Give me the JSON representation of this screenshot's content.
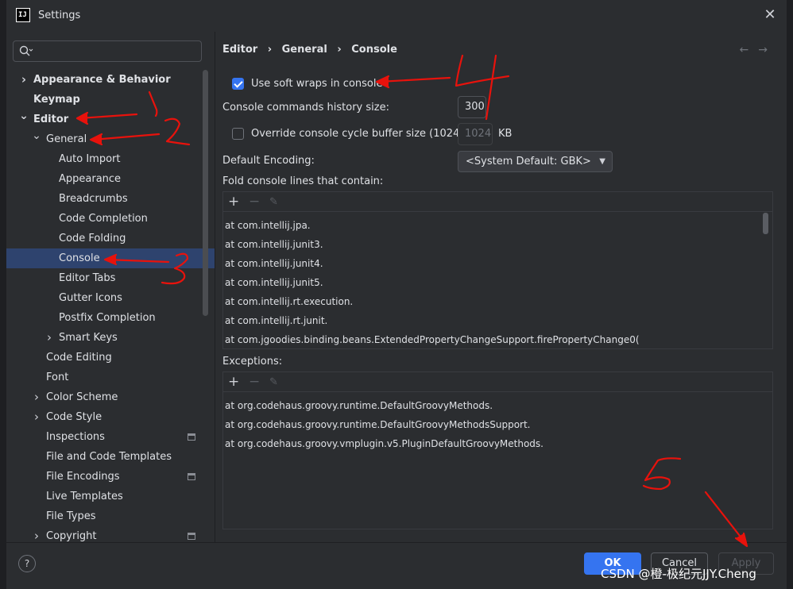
{
  "window": {
    "title": "Settings",
    "app_icon": "IJ"
  },
  "search": {
    "placeholder": ""
  },
  "tree": [
    {
      "label": "Appearance & Behavior",
      "bold": true,
      "chevron": "right"
    },
    {
      "label": "Keymap",
      "bold": true,
      "chevron": ""
    },
    {
      "label": "Editor",
      "bold": true,
      "chevron": "down"
    },
    {
      "label": "General",
      "bold": false,
      "chevron": "down"
    },
    {
      "label": "Auto Import"
    },
    {
      "label": "Appearance"
    },
    {
      "label": "Breadcrumbs"
    },
    {
      "label": "Code Completion"
    },
    {
      "label": "Code Folding"
    },
    {
      "label": "Console",
      "selected": true
    },
    {
      "label": "Editor Tabs"
    },
    {
      "label": "Gutter Icons"
    },
    {
      "label": "Postfix Completion"
    },
    {
      "label": "Smart Keys",
      "chevron": "right"
    },
    {
      "label": "Code Editing"
    },
    {
      "label": "Font"
    },
    {
      "label": "Color Scheme",
      "chevron": "right"
    },
    {
      "label": "Code Style",
      "chevron": "right"
    },
    {
      "label": "Inspections",
      "pinned": true
    },
    {
      "label": "File and Code Templates"
    },
    {
      "label": "File Encodings",
      "pinned": true
    },
    {
      "label": "Live Templates"
    },
    {
      "label": "File Types"
    },
    {
      "label": "Copyright",
      "chevron": "right",
      "pinned": true
    }
  ],
  "breadcrumb": {
    "items": [
      "Editor",
      "General",
      "Console"
    ],
    "sep": "›"
  },
  "nav": {
    "back": "←",
    "forward": "→"
  },
  "settings": {
    "soft_wraps": {
      "label": "Use soft wraps in console",
      "checked": true
    },
    "history": {
      "label": "Console commands history size:",
      "value": "300"
    },
    "cycle_buffer": {
      "label": "Override console cycle buffer size (1024 KB)",
      "checked": false,
      "value": "1024",
      "unit": "KB"
    },
    "encoding": {
      "label": "Default Encoding:",
      "value": "<System Default: GBK>"
    },
    "fold_label": "Fold console lines that contain:",
    "fold_items": [
      "at com.intellij.jpa.",
      "at com.intellij.junit3.",
      "at com.intellij.junit4.",
      "at com.intellij.junit5.",
      "at com.intellij.rt.execution.",
      "at com.intellij.rt.junit.",
      "at com.jgoodies.binding.beans.ExtendedPropertyChangeSupport.firePropertyChange0("
    ],
    "exceptions_label": "Exceptions:",
    "exception_items": [
      "at org.codehaus.groovy.runtime.DefaultGroovyMethods.",
      "at org.codehaus.groovy.runtime.DefaultGroovyMethodsSupport.",
      "at org.codehaus.groovy.vmplugin.v5.PluginDefaultGroovyMethods."
    ],
    "toolbar": {
      "add": "+",
      "remove": "−",
      "edit": "✎"
    }
  },
  "footer": {
    "help": "?",
    "ok": "OK",
    "cancel": "Cancel",
    "apply": "Apply",
    "watermark": "CSDN @橙-极纪元JJY.Cheng"
  },
  "colors": {
    "accent": "#3574f0",
    "selection": "#2e436e",
    "annotation": "#e8120c"
  }
}
